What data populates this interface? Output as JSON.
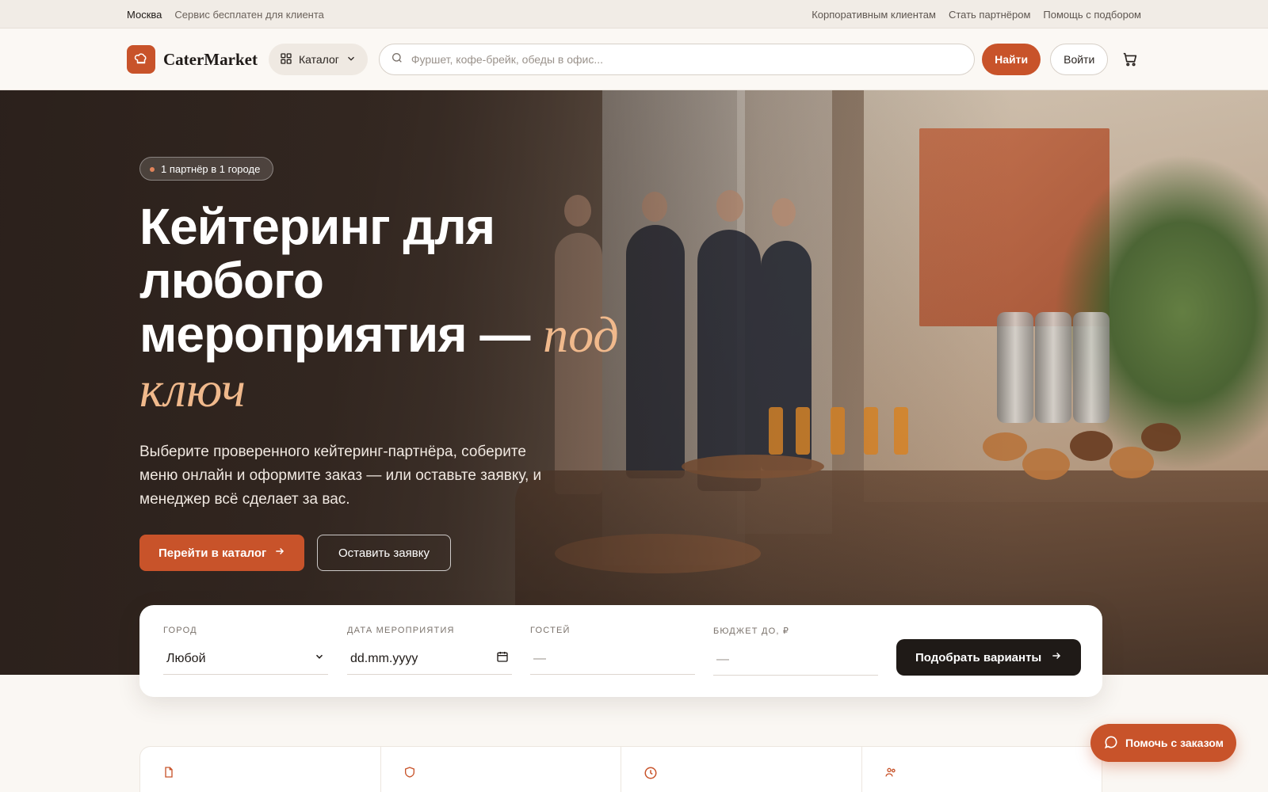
{
  "topbar": {
    "city": "Москва",
    "tagline": "Сервис бесплатен для клиента",
    "links": [
      "Корпоративным клиентам",
      "Стать партнёром",
      "Помощь с подбором"
    ]
  },
  "header": {
    "brand": "CaterMarket",
    "catalog_label": "Каталог",
    "search_placeholder": "Фуршет, кофе-брейк, обеды в офис...",
    "find_label": "Найти",
    "login_label": "Войти"
  },
  "hero": {
    "badge": "1 партнёр в 1 городе",
    "title_main": "Кейтеринг для любого мероприятия — ",
    "title_accent": "под ключ",
    "subtitle": "Выберите проверенного кейтеринг-партнёра, соберите меню онлайн и оформите заказ — или оставьте заявку, и менеджер всё сделает за вас.",
    "primary_cta": "Перейти в каталог",
    "secondary_cta": "Оставить заявку"
  },
  "filter": {
    "city_label": "ГОРОД",
    "city_value": "Любой",
    "date_label": "ДАТА МЕРОПРИЯТИЯ",
    "date_placeholder": "dd.mm.yyyy",
    "guests_label": "ГОСТЕЙ",
    "guests_placeholder": "—",
    "budget_label": "БЮДЖЕТ ДО, ₽",
    "budget_placeholder": "—",
    "submit_label": "Подобрать варианты"
  },
  "chat": {
    "label": "Помочь с заказом"
  },
  "colors": {
    "accent": "#c8532a",
    "dark": "#1f1a17",
    "title_accent": "#f0b98c"
  }
}
